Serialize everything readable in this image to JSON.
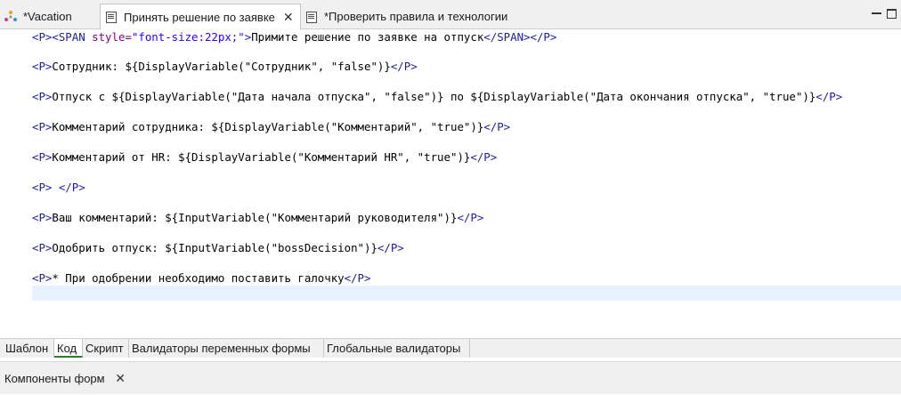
{
  "editor_tabs": [
    {
      "label": "*Vacation",
      "icon": "process-icon",
      "active": false,
      "closable": false
    },
    {
      "label": "Принять решение по заявке",
      "icon": "document-icon",
      "active": true,
      "closable": true
    },
    {
      "label": "*Проверить правила и технологии",
      "icon": "document-icon",
      "active": false,
      "closable": false
    }
  ],
  "close_glyph": "✕",
  "code_lines": [
    [
      {
        "c": "tag",
        "t": "<P><SPAN "
      },
      {
        "c": "attr",
        "t": "style="
      },
      {
        "c": "val",
        "t": "\"font-size:22px;\""
      },
      {
        "c": "tag",
        "t": ">"
      },
      {
        "c": "txt",
        "t": "Примите решение по заявке на отпуск"
      },
      {
        "c": "tag",
        "t": "</SPAN></P>"
      }
    ],
    [
      {
        "c": "tag",
        "t": "<P>"
      },
      {
        "c": "txt",
        "t": "Сотрудник: ${DisplayVariable(\"Сотрудник\", \"false\")}"
      },
      {
        "c": "tag",
        "t": "</P>"
      }
    ],
    [
      {
        "c": "tag",
        "t": "<P>"
      },
      {
        "c": "txt",
        "t": "Отпуск с ${DisplayVariable(\"Дата начала отпуска\", \"false\")} по ${DisplayVariable(\"Дата окончания отпуска\", \"true\")}"
      },
      {
        "c": "tag",
        "t": "</P>"
      }
    ],
    [
      {
        "c": "tag",
        "t": "<P>"
      },
      {
        "c": "txt",
        "t": "Комментарий сотрудника: ${DisplayVariable(\"Комментарий\", \"true\")}"
      },
      {
        "c": "tag",
        "t": "</P>"
      }
    ],
    [
      {
        "c": "tag",
        "t": "<P>"
      },
      {
        "c": "txt",
        "t": "Комментарий от HR: ${DisplayVariable(\"Комментарий HR\", \"true\")}"
      },
      {
        "c": "tag",
        "t": "</P>"
      }
    ],
    [
      {
        "c": "tag",
        "t": "<P>"
      },
      {
        "c": "txt",
        "t": " "
      },
      {
        "c": "tag",
        "t": "</P>"
      }
    ],
    [
      {
        "c": "tag",
        "t": "<P>"
      },
      {
        "c": "txt",
        "t": "Ваш комментарий: ${InputVariable(\"Комментарий руководителя\")}"
      },
      {
        "c": "tag",
        "t": "</P>"
      }
    ],
    [
      {
        "c": "tag",
        "t": "<P>"
      },
      {
        "c": "txt",
        "t": "Одобрить отпуск: ${InputVariable(\"bossDecision\")}"
      },
      {
        "c": "tag",
        "t": "</P>"
      }
    ],
    [
      {
        "c": "tag",
        "t": "<P>"
      },
      {
        "c": "txt",
        "t": "* При одобрении необходимо поставить галочку"
      },
      {
        "c": "tag",
        "t": "</P>"
      }
    ]
  ],
  "page_tabs": [
    {
      "label": "Шаблон",
      "active": false
    },
    {
      "label": "Код",
      "active": true
    },
    {
      "label": "Скрипт",
      "active": false
    },
    {
      "label": "Валидаторы переменных формы",
      "active": false
    },
    {
      "label": "Глобальные валидаторы",
      "active": false
    }
  ],
  "view": {
    "label": "Компоненты форм"
  },
  "colors": {
    "tag": "#1c1c9e",
    "attribute": "#7f007f",
    "string": "#2a00ff",
    "caret_line": "#e8f2fe",
    "active_tab_underline": "#2a7f2a"
  }
}
